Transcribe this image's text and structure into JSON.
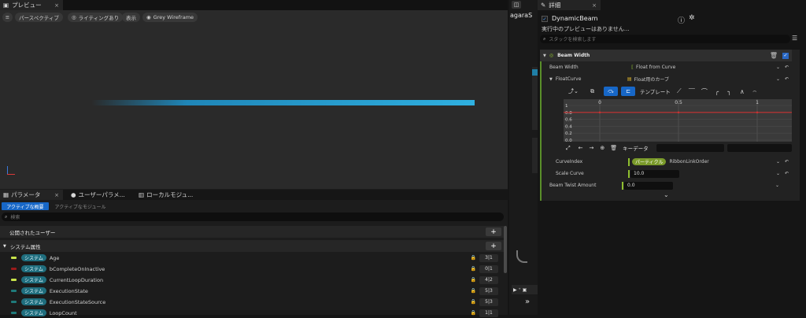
{
  "preview": {
    "tab_label": "プレビュー",
    "close": "×",
    "toolbar": {
      "menu_icon": "menu-icon",
      "perspective": "パースペクティブ",
      "lighting": "ライティングあり",
      "show": "表示",
      "wireframe": "Grey Wireframe"
    }
  },
  "left_bottom": {
    "tabs": [
      {
        "label": "パラメータ"
      },
      {
        "label": "ユーザーパラメ..."
      },
      {
        "label": "ローカルモジュ..."
      }
    ],
    "subtabs": {
      "active": "アクティブな概要",
      "inactive": "アクティブなモジュール"
    },
    "search_placeholder": "検索",
    "public_user": "公開されたユーザー",
    "system_attrs": "システム属性",
    "rows": [
      {
        "tag": "システム",
        "name": "Age",
        "value": "3|1",
        "color": "#c8e34a"
      },
      {
        "tag": "システム",
        "name": "bCompleteOnInactive",
        "value": "0|1",
        "color": "#9b1b1b"
      },
      {
        "tag": "システム",
        "name": "CurrentLoopDuration",
        "value": "4|2",
        "color": "#c8e34a"
      },
      {
        "tag": "システム",
        "name": "ExecutionState",
        "value": "5|3",
        "color": "#1f7a7a"
      },
      {
        "tag": "システム",
        "name": "ExecutionStateSource",
        "value": "5|3",
        "color": "#1f7a7a"
      },
      {
        "tag": "システム",
        "name": "LoopCount",
        "value": "1|1",
        "color": "#1f7a7a"
      }
    ]
  },
  "middle": {
    "graph_title": "agaraS",
    "expand_icon": "chevron-double-right-icon"
  },
  "details": {
    "tab_label": "詳細",
    "close": "×",
    "object_name": "DynamicBeam",
    "no_preview": "実行中のプレビューはありません…",
    "search_placeholder": "スタックを検索します",
    "section": "Beam Width",
    "beam_width_label": "Beam Width",
    "beam_width_value": "Float from Curve",
    "float_curve_label": "FloatCurve",
    "float_curve_value": "Float用のカーブ",
    "template_label": "テンプレート",
    "key_data_label": "キーデータ",
    "curve_index_label": "CurveIndex",
    "curve_index_chip": "パーティクル",
    "curve_index_value": "RibbonLinkOrder",
    "scale_curve_label": "Scale Curve",
    "scale_curve_value": "10.0",
    "twist_label": "Beam Twist Amount",
    "twist_value": "0.0"
  },
  "chart_data": {
    "type": "line",
    "x_ticks": [
      "0",
      "0.5",
      "1"
    ],
    "y_ticks": [
      "1",
      "0.8",
      "0.6",
      "0.4",
      "0.2",
      "0.0"
    ],
    "series": [
      {
        "x": [
          0,
          0.5,
          1
        ],
        "values": [
          0.8,
          0.8,
          0.8
        ]
      }
    ],
    "xlim": [
      -0.2,
      1.2
    ],
    "ylim": [
      0,
      1
    ],
    "line_color": "#c83232"
  }
}
